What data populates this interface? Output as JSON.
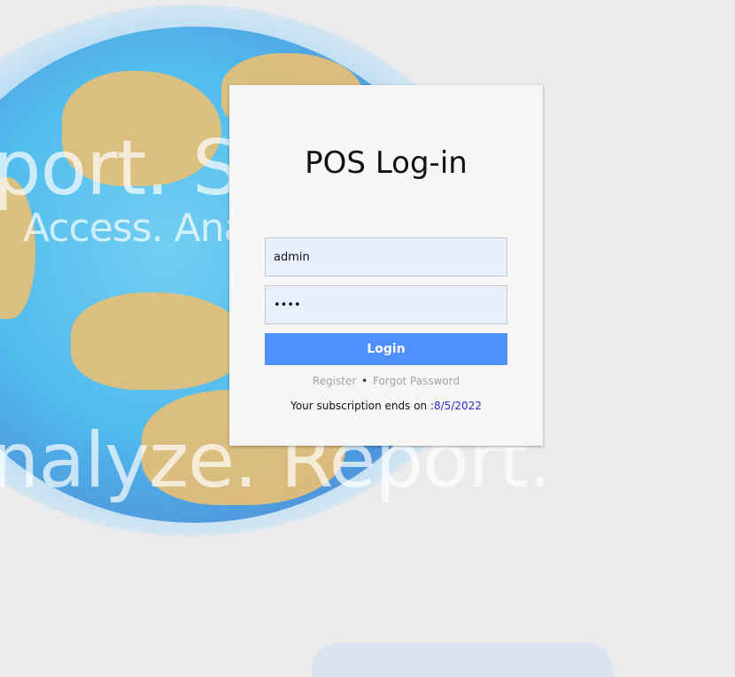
{
  "background": {
    "text_lines": [
      "port. Sh",
      "Access. Analy",
      "nalyze. Report."
    ],
    "globe_color": "#43b8ec",
    "land_color": "#e9bf73"
  },
  "login": {
    "title": "POS Log-in",
    "username_value": "admin",
    "password_value": "1234",
    "login_label": "Login",
    "register_label": "Register",
    "separator": "•",
    "forgot_label": "Forgot Password",
    "subscription_text": "Your subscription ends on :",
    "subscription_date": "8/5/2022",
    "button_color": "#4e90fc",
    "field_bg": "#e8f0fe"
  }
}
